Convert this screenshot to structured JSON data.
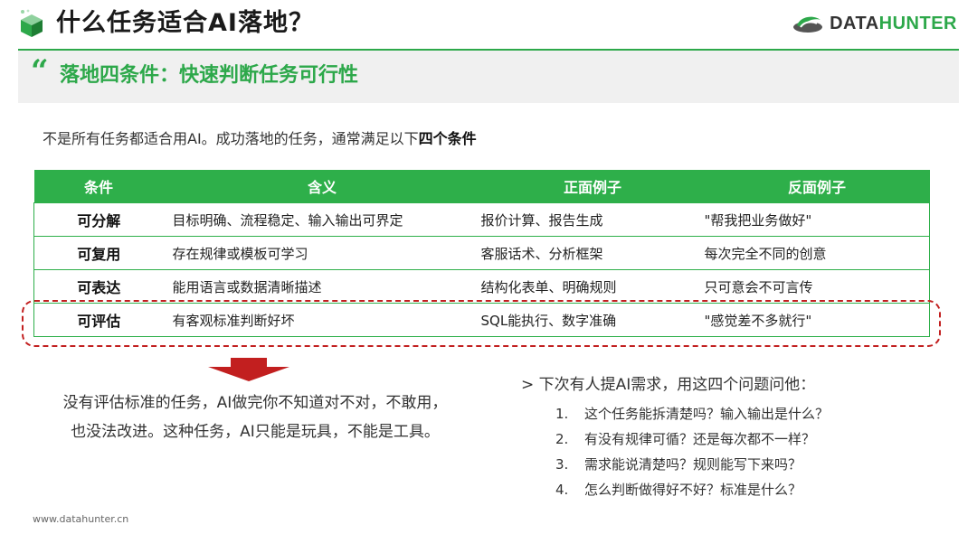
{
  "header": {
    "title": "什么任务适合AI落地？",
    "brand_prefix": "DATA",
    "brand_suffix": "HUNTER"
  },
  "subtitle": {
    "quote": "“",
    "text": "落地四条件：快速判断任务可行性"
  },
  "intro": {
    "text": "不是所有任务都适合用AI。成功落地的任务，通常满足以下",
    "bold": "四个条件"
  },
  "table": {
    "headers": [
      "条件",
      "含义",
      "正面例子",
      "反面例子"
    ],
    "rows": [
      [
        "可分解",
        "目标明确、流程稳定、输入输出可界定",
        "报价计算、报告生成",
        "\"帮我把业务做好\""
      ],
      [
        "可复用",
        "存在规律或模板可学习",
        "客服话术、分析框架",
        "每次完全不同的创意"
      ],
      [
        "可表达",
        "能用语言或数据清晰描述",
        "结构化表单、明确规则",
        "只可意会不可言传"
      ],
      [
        "可评估",
        "有客观标准判断好坏",
        "SQL能执行、数字准确",
        "\"感觉差不多就行\""
      ]
    ]
  },
  "warning": {
    "line1": "没有评估标准的任务，AI做完你不知道对不对，不敢用，",
    "line2": "也没法改进。这种任务，AI只能是玩具，不能是工具。"
  },
  "questions": {
    "heading": "> 下次有人提AI需求，用这四个问题问他：",
    "items": [
      {
        "num": "1.",
        "text": "这个任务能拆清楚吗？输入输出是什么？"
      },
      {
        "num": "2.",
        "text": "有没有规律可循？还是每次都不一样？"
      },
      {
        "num": "3.",
        "text": "需求能说清楚吗？规则能写下来吗？"
      },
      {
        "num": "4.",
        "text": "怎么判断做得好不好？标准是什么？"
      }
    ]
  },
  "footer": {
    "url": "www.datahunter.cn"
  },
  "colors": {
    "accent": "#2da84a",
    "table_header": "#2eaf4a",
    "highlight_dash": "#c21f1f",
    "arrow": "#c21f1f"
  }
}
